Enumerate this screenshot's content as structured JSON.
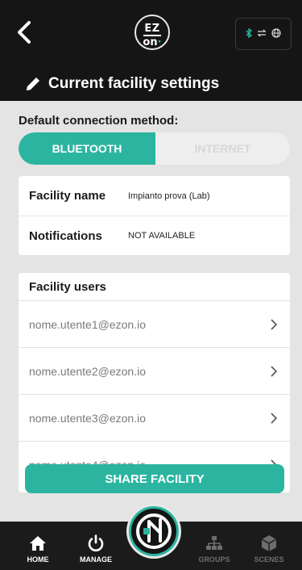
{
  "header": {
    "logo_line1": "EZ",
    "logo_line2": "on",
    "logo_dot": "·",
    "status_icons": [
      "bluetooth-icon",
      "switch-icon",
      "globe-icon"
    ]
  },
  "page": {
    "title": "Current facility settings"
  },
  "connection": {
    "label": "Default connection method:",
    "options": [
      "BLUETOOTH",
      "INTERNET"
    ],
    "selected": "BLUETOOTH"
  },
  "facility": {
    "name_label": "Facility name",
    "name_value": "Impianto prova (Lab)",
    "notifications_label": "Notifications",
    "notifications_value": "NOT AVAILABLE"
  },
  "users": {
    "title": "Facility users",
    "list": [
      "nome.utente1@ezon.io",
      "nome.utente2@ezon.io",
      "nome.utente3@ezon.io",
      "nome.utente4@ezon.io"
    ]
  },
  "actions": {
    "share": "SHARE FACILITY"
  },
  "nav": {
    "home": "HOME",
    "manage": "MANAGE",
    "groups": "GROUPS",
    "scenes": "SCENES"
  },
  "colors": {
    "accent": "#2bb5a0",
    "dark": "#151515",
    "background": "#e4e4e4"
  }
}
